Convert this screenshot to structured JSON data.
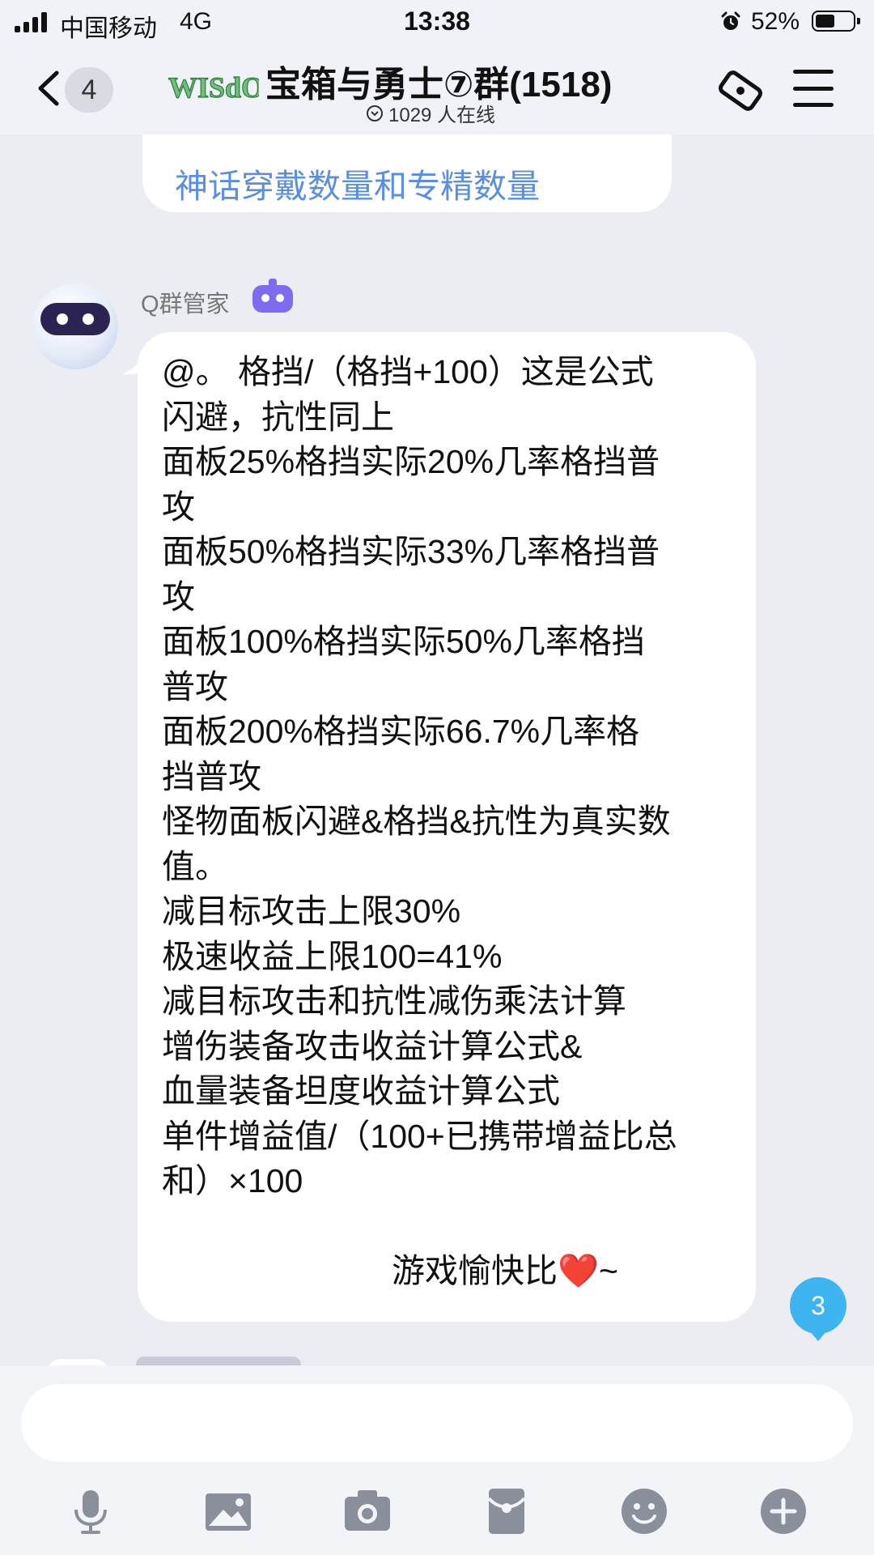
{
  "status_bar": {
    "carrier": "中国移动",
    "network": "4G",
    "time": "13:38",
    "battery_percent": "52%",
    "battery_level": 0.52
  },
  "header": {
    "unread_count": "4",
    "logo_text": "WISdOM",
    "group_name": "宝箱与勇士⑦群(1518)",
    "online_text": "1029 人在线"
  },
  "previous_message": {
    "link_text": "神话穿戴数量和专精数量"
  },
  "message": {
    "sender": "Q群管家",
    "lines": [
      "@。 格挡/（格挡+100）这是公式",
      "闪避，抗性同上",
      "面板25%格挡实际20%几率格挡普",
      "攻",
      "面板50%格挡实际33%几率格挡普",
      "攻",
      "面板100%格挡实际50%几率格挡",
      "普攻",
      "面板200%格挡实际66.7%几率格",
      "挡普攻",
      "怪物面板闪避&格挡&抗性为真实数",
      "值。",
      "减目标攻击上限30%",
      "极速收益上限100=41%",
      "减目标攻击和抗性减伤乘法计算",
      "增伤装备攻击收益计算公式&",
      "血量装备坦度收益计算公式",
      "单件增益值/（100+已携带增益比总",
      "和）×100"
    ],
    "signature": "游戏愉快比❤️~"
  },
  "new_messages_badge": "3",
  "input": {
    "placeholder": ""
  },
  "toolbar_icons": [
    "microphone-icon",
    "image-icon",
    "camera-icon",
    "red-packet-icon",
    "emoji-icon",
    "plus-icon"
  ],
  "colors": {
    "link": "#5a8fe0",
    "badge": "#3eb5f0",
    "bot_badge": "#7d6cf0",
    "toolbar_icon": "#8a8f9c"
  }
}
